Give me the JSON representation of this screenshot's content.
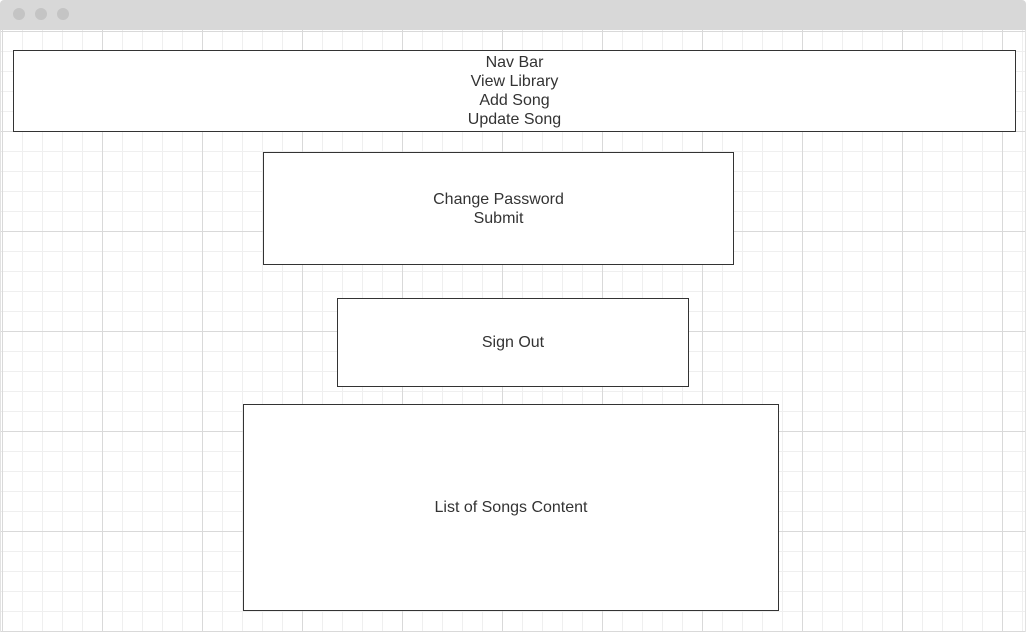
{
  "nav": {
    "title": "Nav Bar",
    "items": [
      "View Library",
      "Add Song",
      "Update Song"
    ]
  },
  "password": {
    "label": "Change Password",
    "submit_label": "Submit"
  },
  "signout": {
    "label": "Sign Out"
  },
  "songs": {
    "label": "List of Songs Content"
  }
}
